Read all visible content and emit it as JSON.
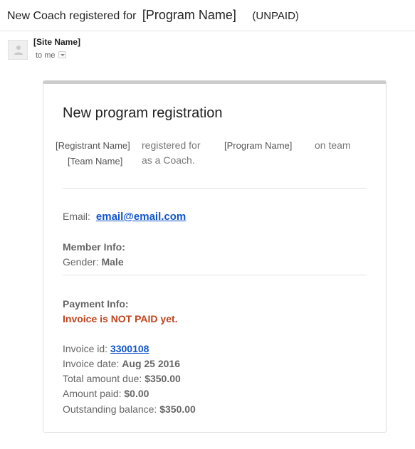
{
  "subject": {
    "title": "New Coach registered for",
    "program": "[Program Name]",
    "status": "(UNPAID)"
  },
  "sender": {
    "name": "[Site Name]",
    "to": "to me",
    "avatar_icon": "person-icon"
  },
  "card": {
    "title": "New program registration",
    "registrant": "[Registrant Name]",
    "registered_for": "registered for",
    "program": "[Program Name]",
    "on_team": "on team",
    "team": "[Team Name]",
    "as_coach": "as a Coach.",
    "email_label": "Email:",
    "email": "email@email.com",
    "member_info": "Member Info:",
    "gender_label": "Gender:",
    "gender": "Male",
    "payment_info": "Payment Info:",
    "not_paid": "Invoice is NOT PAID yet.",
    "invoice_id_label": "Invoice id:",
    "invoice_id": "3300108",
    "invoice_date_label": "Invoice date:",
    "invoice_date": "Aug 25 2016",
    "total_label": "Total amount due:",
    "total": "$350.00",
    "paid_label": "Amount paid:",
    "paid": "$0.00",
    "outstanding_label": "Outstanding balance:",
    "outstanding": "$350.00"
  },
  "colors": {
    "link": "#1155cc",
    "warning": "#c0441d",
    "card_border_top": "#cccccc"
  }
}
